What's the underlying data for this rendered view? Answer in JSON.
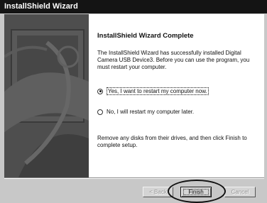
{
  "window": {
    "title": "InstallShield Wizard"
  },
  "main": {
    "heading": "InstallShield Wizard Complete",
    "description": "The InstallShield Wizard has successfully installed Digital Camera USB Device3.  Before you can use the program, you must restart your computer.",
    "options": [
      {
        "label": "Yes, I want to restart my computer now.",
        "selected": true
      },
      {
        "label": "No, I will restart my computer later.",
        "selected": false
      }
    ],
    "footer_note": "Remove any disks from their drives, and then click Finish to complete setup."
  },
  "buttons": {
    "back": "< Back",
    "finish": "Finish",
    "cancel": "Cancel"
  },
  "colors": {
    "titlebar": "#141414",
    "side_panel": "#4e4e4e",
    "dialog_bg": "#c8c8c8"
  }
}
